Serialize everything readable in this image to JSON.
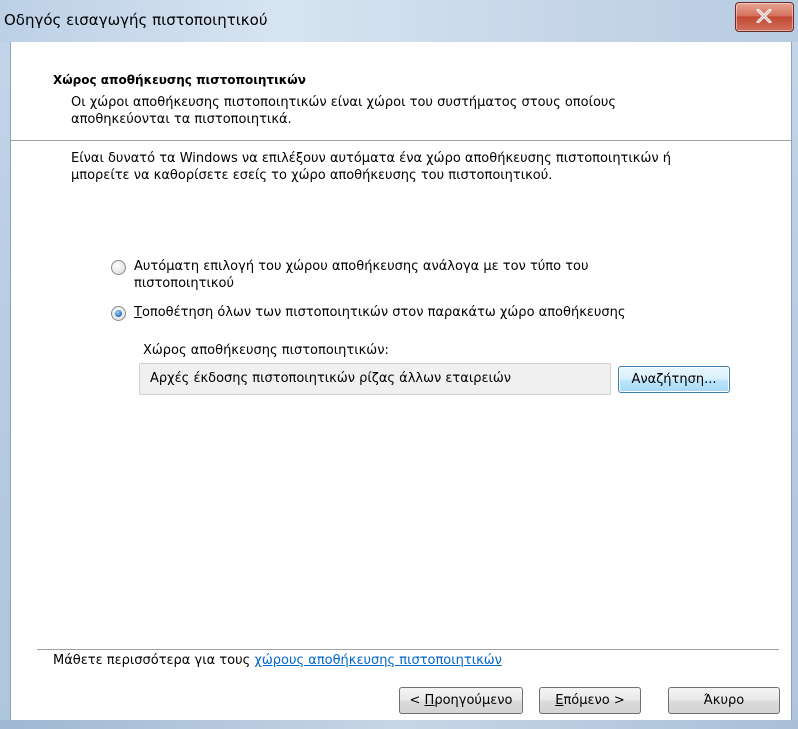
{
  "window": {
    "title": "Οδηγός εισαγωγής πιστοποιητικού",
    "close_symbol": "X"
  },
  "header": {
    "title": "Χώρος αποθήκευσης πιστοποιητικών",
    "description": "Οι χώροι αποθήκευσης πιστοποιητικών είναι χώροι του συστήματος στους οποίους αποθηκεύονται τα πιστοποιητικά."
  },
  "body": {
    "intro": "Είναι δυνατό τα Windows να επιλέξουν αυτόματα ένα χώρο αποθήκευσης πιστοποιητικών ή μπορείτε να καθορίσετε εσείς το χώρο αποθήκευσης του πιστοποιητικού.",
    "option_auto": {
      "pre": "Αυτόματη επιλογή του ",
      "mnemonic": "χ",
      "post": "ώρου αποθήκευσης ανάλογα με τον τύπο του πιστοποιητικού",
      "checked": false
    },
    "option_manual": {
      "mnemonic": "Τ",
      "post": "οποθέτηση όλων των πιστοποιητικών στον παρακάτω χώρο αποθήκευσης",
      "checked": true
    },
    "store_label": "Χώρος αποθήκευσης πιστοποιητικών:",
    "store_value": "Αρχές έκδοσης πιστοποιητικών ρίζας άλλων εταιρειών",
    "browse_button": "Αναζήτηση...",
    "learn_more_prefix": "Μάθετε περισσότερα για τους ",
    "learn_more_link": "χώρους αποθήκευσης πιστοποιητικών"
  },
  "footer": {
    "back_pre": "< ",
    "back_mnemonic": "Π",
    "back_post": "ροηγούμενο",
    "next_mnemonic": "Ε",
    "next_post": "πόμενο >",
    "cancel": "Άκυρο"
  },
  "colors": {
    "link": "#0066cc",
    "close_button": "#c24a35",
    "focus_button": "#3c7fb1"
  }
}
